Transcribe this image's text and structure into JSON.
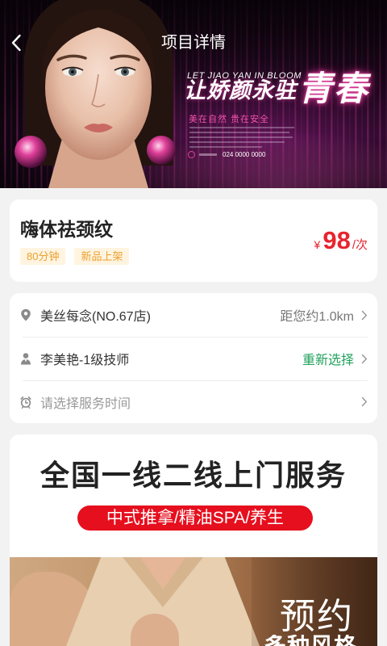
{
  "header": {
    "title": "项目详情",
    "back_icon": "chevron-left-icon"
  },
  "banner": {
    "tagline_en": "LET JIAO YAN IN BLOOM",
    "headline": "让娇颜永驻",
    "headline_highlight": "青春",
    "slogan": "美在自然 贵在安全",
    "phone": "024 0000 0000"
  },
  "service": {
    "name": "嗨体祛颈纹",
    "tags": [
      "80分钟",
      "新品上架"
    ],
    "price": {
      "currency": "¥",
      "amount": "98",
      "unit": "/次"
    }
  },
  "booking": {
    "store": {
      "icon": "location-pin-icon",
      "label": "美丝每念(NO.67店)",
      "distance": "距您约1.0km"
    },
    "technician": {
      "icon": "technician-icon",
      "label": "李美艳-1级技师",
      "action": "重新选择"
    },
    "time": {
      "icon": "clock-icon",
      "placeholder": "请选择服务时间"
    },
    "chevron_icon": "chevron-right-icon"
  },
  "promo": {
    "title": "全国一线二线上门服务",
    "categories": "中式推拿/精油SPA/养生",
    "photo_caption": "预约",
    "photo_caption_sub": "多种风格"
  },
  "theme": {
    "page_bg": "#f2f2f2",
    "price_red": "#e8242f",
    "tag_text": "#eba02e",
    "tag_bg": "#fff4e0",
    "action_green": "#22a25d",
    "pill_red": "#e60f1e",
    "banner_accent": "#e0409a"
  }
}
